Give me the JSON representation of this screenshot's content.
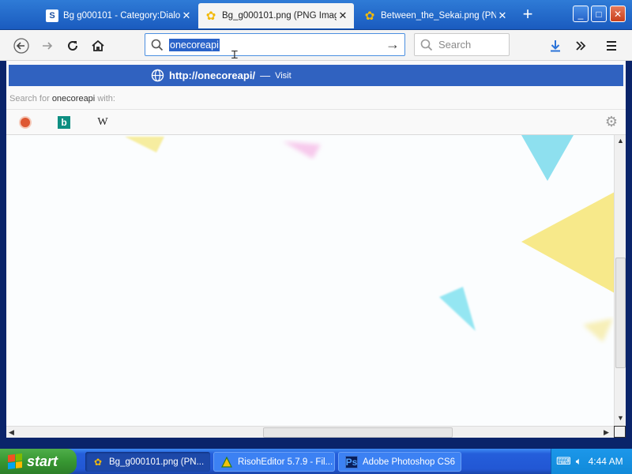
{
  "tabs": [
    {
      "label": "Bg g000101 - Category:Dialo",
      "icon": "s-favicon-icon",
      "active": false
    },
    {
      "label": "Bg_g000101.png (PNG Image",
      "icon": "flower-favicon-icon",
      "active": true
    },
    {
      "label": "Between_the_Sekai.png (PNG",
      "icon": "flower-favicon-icon",
      "active": false
    }
  ],
  "window": {
    "new_tab": "+",
    "minimize": "_",
    "maximize": "□",
    "close": "✕"
  },
  "navbar": {
    "url_value": "onecoreapi",
    "search_placeholder": "Search"
  },
  "suggestions": {
    "url": "http://onecoreapi/",
    "separator": "—",
    "action": "Visit",
    "search_for_prefix": "Search for",
    "search_term": "onecoreapi",
    "search_for_suffix": "with:",
    "engines": [
      "DuckDuckGo",
      "Bing",
      "Wikipedia"
    ],
    "wiki_glyph": "W",
    "bing_glyph": "b"
  },
  "taskbar": {
    "start_label": "start",
    "items": [
      {
        "label": "Bg_g000101.png (PN...",
        "icon": "firefox-icon",
        "active": true
      },
      {
        "label": "RisohEditor 5.7.9 - Fil...",
        "icon": "risoh-icon",
        "active": false
      },
      {
        "label": "Adobe Photoshop CS6",
        "icon": "photoshop-icon",
        "active": false
      }
    ],
    "ps_glyph": "Ps",
    "clock": "4:44 AM"
  },
  "colors": {
    "accent": "#3062c0",
    "titlebar": "#1a5bbf",
    "taskbar": "#245edb",
    "start": "#379732"
  }
}
